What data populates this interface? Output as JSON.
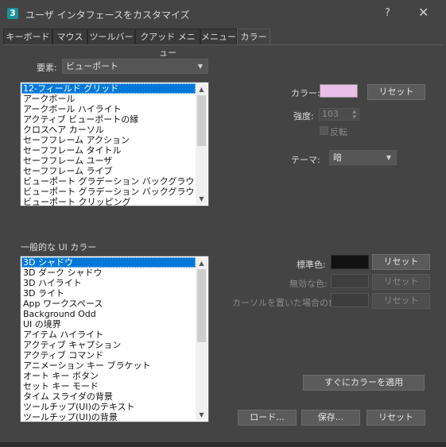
{
  "window": {
    "title": "ユーザ インタフェースをカスタマイズ",
    "help": "?",
    "close": "✕",
    "app_icon": "3"
  },
  "tabs": [
    "キーボード",
    "マウス",
    "ツールバー",
    "クアッド メニュー",
    "メニュー",
    "カラー"
  ],
  "element": {
    "label": "要素:",
    "value": "ビューポート"
  },
  "viewport_list": {
    "items": [
      "12-フィールド グリッド",
      "アークボール",
      "アークボール ハイライト",
      "アクティブ ビューポートの縁",
      "クロスヘア カーソル",
      "セーフフレーム アクション",
      "セーフフレーム タイトル",
      "セーフフレーム ユーザ",
      "セーフフレーム ライブ",
      "ビューポート グラデーション バックグラウンド トップ",
      "ビューポート グラデーション バックグラウンド ボトム",
      "ビューポート クリッピング"
    ],
    "selected_index": 0
  },
  "color_panel": {
    "color_label": "カラー:",
    "color_value": "#e8bfe6",
    "reset_label": "リセット",
    "intensity_label": "強度:",
    "intensity_value": "103",
    "invert_label": "反転",
    "theme_label": "テーマ:",
    "theme_value": "暗"
  },
  "general_ui": {
    "section_label": "一般的な UI カラー",
    "items": [
      "3D シャドウ",
      "3D ダーク シャドウ",
      "3D ハイライト",
      "3D ライト",
      "App ワークスペース",
      "Background Odd",
      "UI の境界",
      "アイテム ハイライト",
      "アクティブ キャプション",
      "アクティブ コマンド",
      "アニメーション キー ブラケット",
      "オート キー ボタン",
      "セット キー モード",
      "タイム スライダの背景",
      "ツールチップ(UI)のテキスト",
      "ツールチップ(UI)の背景"
    ],
    "selected_index": 0
  },
  "ui_colors": {
    "standard_label": "標準色:",
    "standard_color": "#111111",
    "disabled_label": "無効な色:",
    "hover_label": "カーソルを置いた場合の色:",
    "reset_label": "リセット"
  },
  "actions": {
    "apply_now": "すぐにカラーを適用",
    "load": "ロード...",
    "save": "保存...",
    "reset": "リセット"
  },
  "colors": {
    "background": "#444444",
    "selection": "#0078d7"
  }
}
